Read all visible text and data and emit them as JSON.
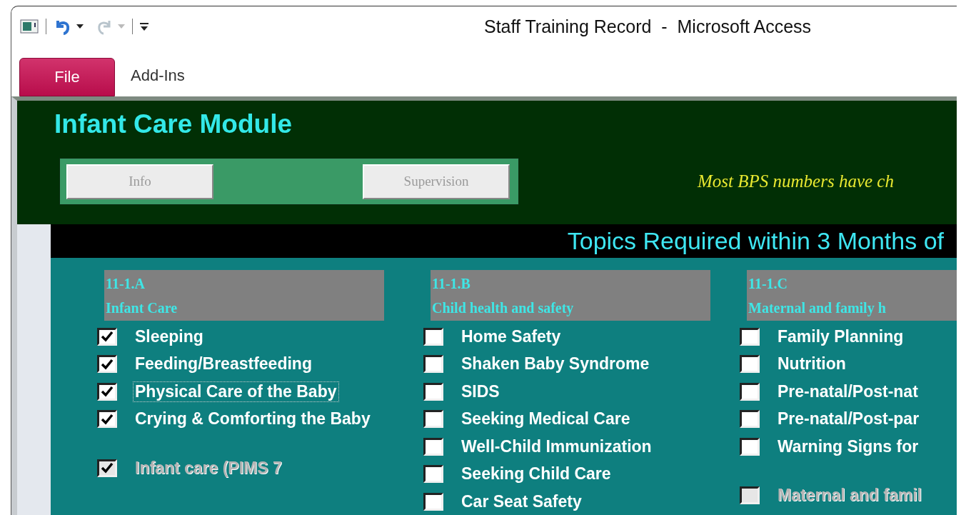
{
  "window": {
    "title": "Staff Training Record  -  Microsoft Access"
  },
  "quick_access": {
    "undo": {
      "disabled": false
    },
    "redo": {
      "disabled": true
    }
  },
  "ribbon_tabs": [
    {
      "label": "File",
      "kind": "file"
    },
    {
      "label": "Add-Ins",
      "kind": "tab"
    }
  ],
  "form": {
    "title": "Infant Care Module",
    "buttons": [
      {
        "label": "Info",
        "disabled": true
      },
      {
        "label": "Supervision",
        "disabled": true
      }
    ],
    "notice": "Most BPS numbers have ch",
    "section_heading": "Topics Required within 3 Months of",
    "columns": [
      {
        "code": "11-1.A",
        "name": "Infant Care",
        "items": [
          {
            "label": "Sleeping",
            "checked": true,
            "focused": false
          },
          {
            "label": "Feeding/Breastfeeding",
            "checked": true,
            "focused": false
          },
          {
            "label": "Physical Care of the Baby",
            "checked": true,
            "focused": true
          },
          {
            "label": "Crying & Comforting the Baby",
            "checked": true,
            "focused": false
          }
        ],
        "summary": {
          "label": "Infant care (PIMS 7",
          "checked": true,
          "disabled": true
        }
      },
      {
        "code": "11-1.B",
        "name": "Child health and safety",
        "items": [
          {
            "label": "Home Safety",
            "checked": false,
            "focused": false
          },
          {
            "label": "Shaken Baby Syndrome",
            "checked": false,
            "focused": false
          },
          {
            "label": "SIDS",
            "checked": false,
            "focused": false
          },
          {
            "label": "Seeking Medical Care",
            "checked": false,
            "focused": false
          },
          {
            "label": "Well-Child Immunization",
            "checked": false,
            "focused": false
          },
          {
            "label": "Seeking Child Care",
            "checked": false,
            "focused": false
          },
          {
            "label": "Car Seat Safety",
            "checked": false,
            "focused": false
          }
        ]
      },
      {
        "code": "11-1.C",
        "name": "Maternal and family h",
        "items": [
          {
            "label": "Family Planning",
            "checked": false,
            "focused": false
          },
          {
            "label": "Nutrition",
            "checked": false,
            "focused": false
          },
          {
            "label": "Pre-natal/Post-nat",
            "checked": false,
            "focused": false
          },
          {
            "label": "Pre-natal/Post-par",
            "checked": false,
            "focused": false
          },
          {
            "label": "Warning Signs for",
            "checked": false,
            "focused": false
          }
        ],
        "summary": {
          "label": "Maternal and famil",
          "checked": false,
          "disabled": true
        }
      }
    ]
  }
}
